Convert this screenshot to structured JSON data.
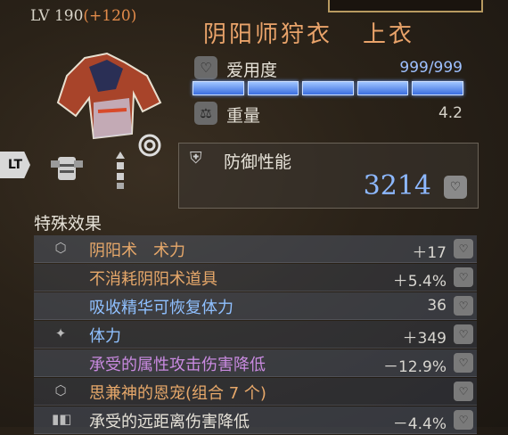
{
  "level": {
    "label": "LV 190",
    "bonus": "(+120)"
  },
  "item": {
    "name": "阴阳师狩衣",
    "slot": "上衣"
  },
  "stats": {
    "durability": {
      "label": "爱用度",
      "value": "999/999",
      "fill_fraction": 1.0
    },
    "weight": {
      "label": "重量",
      "value": "4.2"
    }
  },
  "defense": {
    "label": "防御性能",
    "value": "3214"
  },
  "special_title": "特殊效果",
  "effects": [
    {
      "name": "阴阳术　术力",
      "value": "＋17",
      "color": "#e7a86a",
      "icon": "hex-gem-icon"
    },
    {
      "name": "不消耗阴阳术道具",
      "value": "＋5.4%",
      "color": "#e7a86a",
      "icon": ""
    },
    {
      "name": "吸收精华可恢复体力",
      "value": "36",
      "color": "#8fc0ff",
      "icon": ""
    },
    {
      "name": "体力",
      "value": "＋349",
      "color": "#8fc0ff",
      "icon": "sparkle-icon"
    },
    {
      "name": "承受的属性攻击伤害降低",
      "value": "－12.9%",
      "color": "#c98ae0",
      "icon": ""
    },
    {
      "name": "思兼神的恩宠(组合 7 个)",
      "value": "",
      "color": "#e7a86a",
      "icon": "hex-gem-icon"
    },
    {
      "name": "承受的远距离伤害降低",
      "value": "－4.4%",
      "color": "#e6e2d8",
      "icon": "set-icon"
    }
  ],
  "controls": {
    "lt_label": "LT"
  },
  "colors": {
    "defense_value": "#8db8ff",
    "durability_bar": "#3b6fe0",
    "title": "#e9a36a"
  }
}
